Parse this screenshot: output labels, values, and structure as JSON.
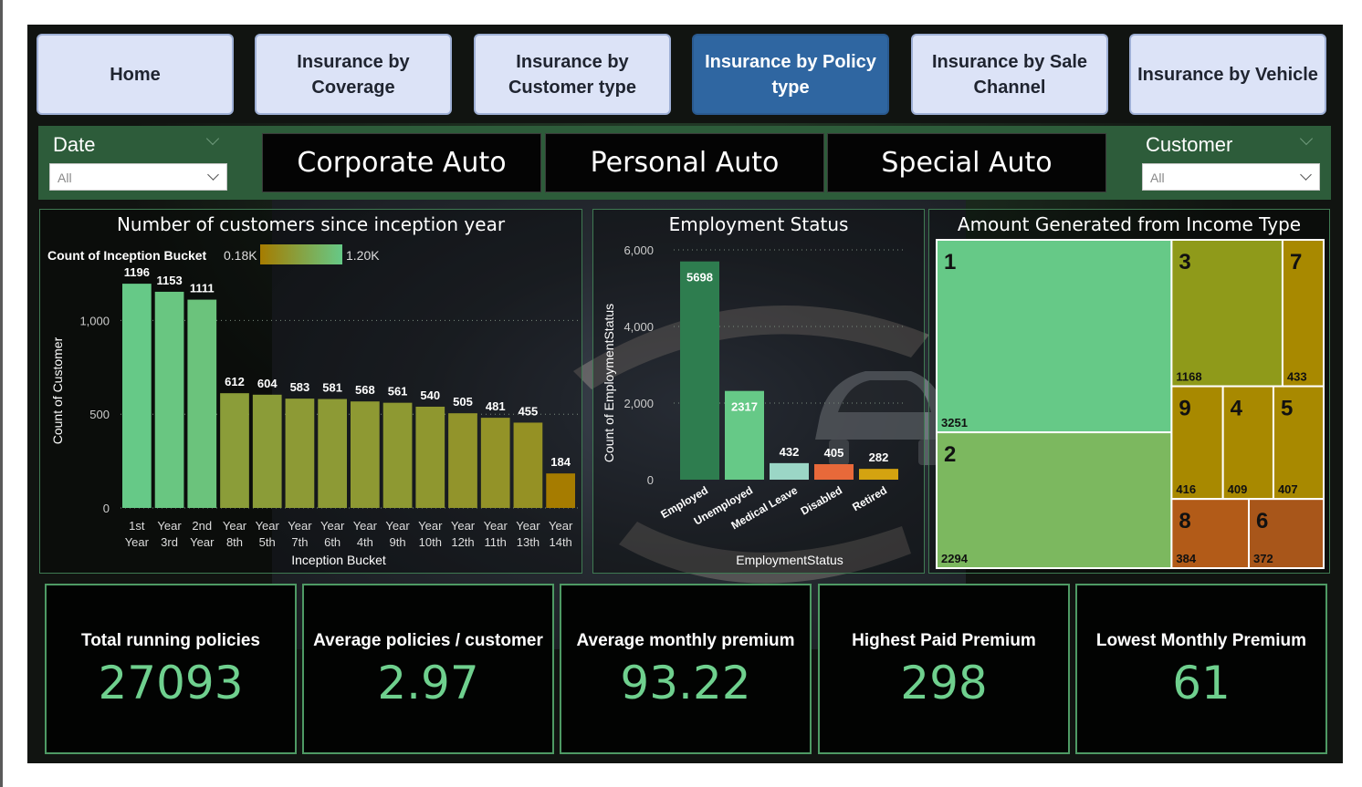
{
  "nav": {
    "buttons": [
      {
        "label": "Home",
        "active": false
      },
      {
        "label": "Insurance by Coverage",
        "active": false
      },
      {
        "label": "Insurance by Customer type",
        "active": false
      },
      {
        "label": "Insurance by Policy type",
        "active": true
      },
      {
        "label": "Insurance by Sale Channel",
        "active": false
      },
      {
        "label": "Insurance by Vehicle",
        "active": false
      }
    ]
  },
  "slicers": {
    "date": {
      "title": "Date",
      "selected": "All"
    },
    "customer": {
      "title": "Customer",
      "selected": "All"
    }
  },
  "policy_tiles": [
    "Corporate Auto",
    "Personal Auto",
    "Special Auto"
  ],
  "colors": {
    "accent_green": "#6fd08e",
    "nav_active": "#2f66a1",
    "nav_default": "#dce3f7",
    "panel_border": "#3f7a52",
    "slicer_strip": "#2d5c3a"
  },
  "chart_data": [
    {
      "type": "bar",
      "title": "Number of customers since inception year",
      "legend_title": "Count of Inception Bucket",
      "legend_min_label": "0.18K",
      "legend_max_label": "1.20K",
      "xlabel": "Inception Bucket",
      "ylabel": "Count of Customer",
      "ylim": [
        0,
        1250
      ],
      "yticks": [
        0,
        500,
        1000
      ],
      "ytick_labels": [
        "0",
        "500",
        "1,000"
      ],
      "categories": [
        "1st Year",
        "Year 3rd",
        "2nd Year",
        "Year 8th",
        "Year 5th",
        "Year 7th",
        "Year 6th",
        "Year 4th",
        "Year 9th",
        "Year 10th",
        "Year 12th",
        "Year 11th",
        "Year 13th",
        "Year 14th"
      ],
      "values": [
        1196,
        1153,
        1111,
        612,
        604,
        583,
        581,
        568,
        561,
        540,
        505,
        481,
        455,
        184
      ],
      "color_min": "#a67c00",
      "color_max": "#66c987"
    },
    {
      "type": "bar",
      "title": "Employment Status",
      "xlabel": "EmploymentStatus",
      "ylabel": "Count of EmploymentStatus",
      "ylim": [
        0,
        6000
      ],
      "yticks": [
        0,
        2000,
        4000,
        6000
      ],
      "ytick_labels": [
        "0",
        "2,000",
        "4,000",
        "6,000"
      ],
      "categories": [
        "Employed",
        "Unemployed",
        "Medical Leave",
        "Disabled",
        "Retired"
      ],
      "values": [
        5698,
        2317,
        432,
        405,
        282
      ],
      "colors": [
        "#2e7d4f",
        "#66c987",
        "#9bd6c6",
        "#e8693a",
        "#d4a310"
      ]
    },
    {
      "type": "treemap",
      "title": "Amount Generated from Income Type",
      "items": [
        {
          "label": "1",
          "value": 3251,
          "color": "#66c987"
        },
        {
          "label": "2",
          "value": 2294,
          "color": "#7cb85f"
        },
        {
          "label": "3",
          "value": 1168,
          "color": "#8f9a1a"
        },
        {
          "label": "7",
          "value": 433,
          "color": "#a88900"
        },
        {
          "label": "9",
          "value": 416,
          "color": "#a88900"
        },
        {
          "label": "4",
          "value": 409,
          "color": "#a88900"
        },
        {
          "label": "5",
          "value": 407,
          "color": "#a88900"
        },
        {
          "label": "8",
          "value": 384,
          "color": "#b25b18"
        },
        {
          "label": "6",
          "value": 372,
          "color": "#a8561a"
        }
      ]
    }
  ],
  "kpis": [
    {
      "label": "Total running policies",
      "value": "27093"
    },
    {
      "label": "Average policies / customer",
      "value": "2.97"
    },
    {
      "label": "Average monthly premium",
      "value": "93.22"
    },
    {
      "label": "Highest Paid Premium",
      "value": "298"
    },
    {
      "label": "Lowest Monthly Premium",
      "value": "61"
    }
  ]
}
